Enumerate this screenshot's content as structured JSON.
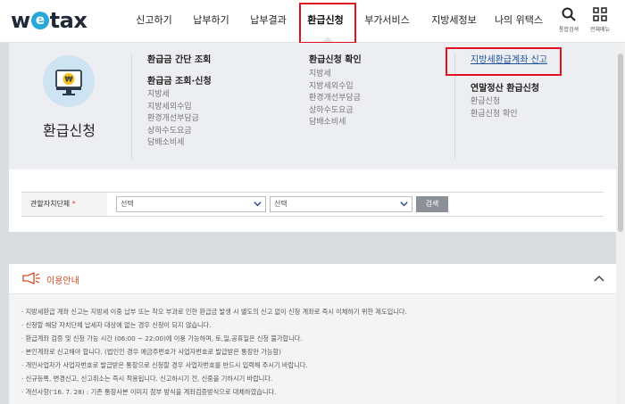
{
  "header": {
    "logo_pre": "w",
    "logo_e": "e",
    "logo_post": "tax",
    "nav": [
      {
        "label": "신고하기",
        "width": 65
      },
      {
        "label": "납부하기",
        "width": 63
      },
      {
        "label": "납부결과",
        "width": 65
      },
      {
        "label": "환급신청",
        "width": 63,
        "active": true
      },
      {
        "label": "부가서비스",
        "width": 75
      },
      {
        "label": "지방세정보",
        "width": 75
      },
      {
        "label": "나의 위택스",
        "width": 70
      }
    ],
    "search_label": "통합검색",
    "menu_label": "전체메뉴"
  },
  "mega": {
    "title": "환급신청",
    "col1": {
      "head": "환급금 간단 조회",
      "head2": "환급금 조회·신청",
      "items": [
        "지방세",
        "지방세외수입",
        "환경개선부담금",
        "상하수도요금",
        "담배소비세"
      ]
    },
    "col2": {
      "head": "환급신청 확인",
      "items": [
        "지방세",
        "지방세외수입",
        "환경개선부담금",
        "상하수도요금",
        "담배소비세"
      ]
    },
    "col3": {
      "link": "지방세환급계좌 신고",
      "head2": "연말정산 환급신청",
      "items": [
        "환급신청",
        "환급신청 확인"
      ]
    }
  },
  "filter": {
    "label": "관할자치단체",
    "required_mark": "*",
    "select1": "선택",
    "select2": "선택",
    "search_button": "검색"
  },
  "guide": {
    "title": "이용안내",
    "lines": [
      "· 지방세환급 계좌 신고는 지방세 이중 납부 또는 착오 부과로 인한 환급금 발생 시 별도의 신고 없이 신청 계좌로 즉시 이체하기 위한 제도입니다.",
      "· 신청할 해당 자치단체 납세자 대상에 없는 경우 신청이 되지 않습니다.",
      "· 환급계좌 검증 및 신청 가능 시간 (06:00 ~ 22:00)에 이용 가능하며, 토,일,공휴일은 신청 불가합니다.",
      "· 본인계좌로 신고해야 합니다. (법인인 경우 예금주번호가 사업자번호로 발급받은 통장만 가능함)",
      "· 개인사업자가 사업자번호로 발급받은 통장으로 신청할 경우 사업자번호를 반드시 입력해 주시기 바랍니다.",
      "· 신규등록, 변경신고, 신고취소는 즉시 적용됩니다. 신고하시기 전, 신중을 기하시기 바랍니다.",
      "· 개선사항('16. 7. 28) : 기존 통장사본 이미지 첨부 방식을 계좌검증방식으로 대체하였습니다."
    ]
  },
  "colors": {
    "highlight": "#e01020",
    "link": "#1d4f9c",
    "accent": "#27a8d9",
    "guide_title": "#d6491f"
  }
}
